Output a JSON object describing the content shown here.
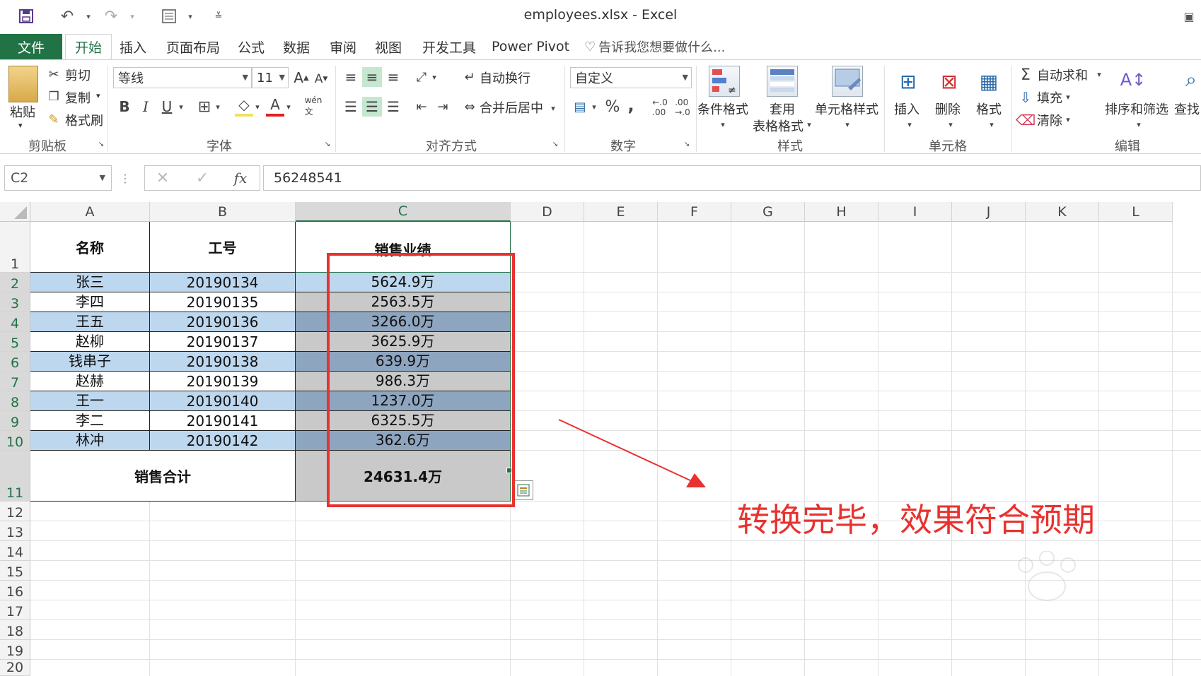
{
  "window": {
    "title": "employees.xlsx - Excel"
  },
  "tabs": [
    "文件",
    "开始",
    "插入",
    "页面布局",
    "公式",
    "数据",
    "审阅",
    "视图",
    "开发工具",
    "Power Pivot"
  ],
  "active_tab": "开始",
  "tell_me": "告诉我您想要做什么...",
  "ribbon": {
    "clipboard": {
      "paste": "粘贴",
      "cut": "剪切",
      "copy": "复制",
      "format_painter": "格式刷",
      "label": "剪贴板"
    },
    "font": {
      "name": "等线",
      "size": "11",
      "bold": "B",
      "italic": "I",
      "underline": "U",
      "label": "字体"
    },
    "alignment": {
      "wrap": "自动换行",
      "merge": "合并后居中",
      "label": "对齐方式"
    },
    "number": {
      "format": "自定义",
      "percent": "%",
      "comma": ",",
      "label": "数字"
    },
    "styles": {
      "conditional": "条件格式",
      "table_format_1": "套用",
      "table_format_2": "表格格式",
      "cell_styles": "单元格样式",
      "label": "样式"
    },
    "cells": {
      "insert": "插入",
      "delete": "删除",
      "format": "格式",
      "label": "单元格"
    },
    "editing": {
      "autosum": "自动求和",
      "fill": "填充",
      "clear": "清除",
      "sort": "排序和筛选",
      "find": "查找",
      "label": "编辑"
    }
  },
  "formula_bar": {
    "name_box": "C2",
    "fx": "fx",
    "value": "56248541"
  },
  "columns": [
    "A",
    "B",
    "C",
    "D",
    "E",
    "F",
    "G",
    "H",
    "I",
    "J",
    "K",
    "L"
  ],
  "rows": [
    "1",
    "2",
    "3",
    "4",
    "5",
    "6",
    "7",
    "8",
    "9",
    "10",
    "11",
    "12",
    "13",
    "14",
    "15",
    "16",
    "17",
    "18",
    "19",
    "20"
  ],
  "table": {
    "headers": [
      "名称",
      "工号",
      "销售业绩"
    ],
    "records": [
      [
        "张三",
        "20190134",
        "5624.9万"
      ],
      [
        "李四",
        "20190135",
        "2563.5万"
      ],
      [
        "王五",
        "20190136",
        "3266.0万"
      ],
      [
        "赵柳",
        "20190137",
        "3625.9万"
      ],
      [
        "钱串子",
        "20190138",
        "639.9万"
      ],
      [
        "赵赫",
        "20190139",
        "986.3万"
      ],
      [
        "王一",
        "20190140",
        "1237.0万"
      ],
      [
        "李二",
        "20190141",
        "6325.5万"
      ],
      [
        "林冲",
        "20190142",
        "362.6万"
      ]
    ],
    "total_label": "销售合计",
    "total_value": "24631.4万"
  },
  "annotation": "转换完毕，效果符合预期",
  "colors": {
    "excel_green": "#217346",
    "row_blue": "#bdd7ee",
    "sel_gray": "#c9c9c9",
    "sel_blue": "#8ea5bf",
    "annotation_red": "#e8322f"
  }
}
